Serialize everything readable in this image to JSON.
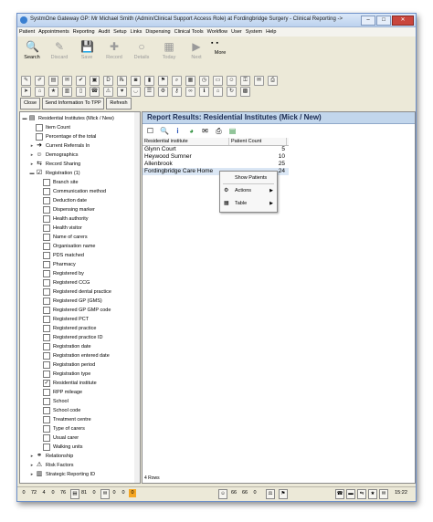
{
  "window": {
    "title": "SystmOne Gateway GP: Mr Michael Smith (Admin/Clinical Support Access Role) at Fordingbridge Surgery - Clinical Reporting ->",
    "controls": [
      "–",
      "□",
      "✕"
    ]
  },
  "menu": [
    "Patient",
    "Appointments",
    "Reporting",
    "Audit",
    "Setup",
    "Links",
    "Dispensing",
    "Clinical Tools",
    "Workflow",
    "User",
    "System",
    "Help"
  ],
  "toolbar": {
    "buttons": [
      {
        "label": "Search",
        "icon": "magnifier-icon",
        "glyph": "🔍",
        "disabled": false
      },
      {
        "label": "Discard",
        "icon": "discard-icon",
        "glyph": "✎",
        "disabled": true
      },
      {
        "label": "Save",
        "icon": "save-icon",
        "glyph": "💾",
        "disabled": true
      },
      {
        "label": "Record",
        "icon": "record-icon",
        "glyph": "✚",
        "disabled": true
      },
      {
        "label": "Details",
        "icon": "details-icon",
        "glyph": "○",
        "disabled": true
      },
      {
        "label": "Today",
        "icon": "today-icon",
        "glyph": "▦",
        "disabled": true
      },
      {
        "label": "Next",
        "icon": "next-icon",
        "glyph": "▶",
        "disabled": true
      },
      {
        "label": "More",
        "icon": "more-icon",
        "glyph": "▪",
        "disabled": false
      }
    ]
  },
  "buttons": {
    "close": "Close",
    "send_info": "Send Information To TPP",
    "refresh": "Refresh"
  },
  "tree": [
    {
      "label": "Residential Institutes (Mick / New)",
      "level": 0,
      "expander": "▬",
      "icon": "doc-icon",
      "glyph": "▤",
      "checkbox": false
    },
    {
      "label": "Item Count",
      "level": 1,
      "checkbox": true,
      "checked": false
    },
    {
      "label": "Percentage of the total",
      "level": 1,
      "checkbox": true,
      "checked": false
    },
    {
      "label": "Current Referrals In",
      "level": 1,
      "expander": "▸",
      "icon": "arrow-right-icon",
      "glyph": "➜",
      "checkbox": false
    },
    {
      "label": "Demographics",
      "level": 1,
      "expander": "▸",
      "icon": "people-icon",
      "glyph": "☺",
      "checkbox": false
    },
    {
      "label": "Record Sharing",
      "level": 1,
      "expander": "▸",
      "icon": "sharing-icon",
      "glyph": "⇆",
      "checkbox": false
    },
    {
      "label": "Registration (1)",
      "level": 1,
      "expander": "▬",
      "icon": "registration-icon",
      "glyph": "☑",
      "checkbox": false
    },
    {
      "label": "Branch site",
      "level": 2,
      "checkbox": true,
      "checked": false
    },
    {
      "label": "Communication method",
      "level": 2,
      "checkbox": true,
      "checked": false
    },
    {
      "label": "Deduction date",
      "level": 2,
      "checkbox": true,
      "checked": false
    },
    {
      "label": "Dispensing marker",
      "level": 2,
      "checkbox": true,
      "checked": false
    },
    {
      "label": "Health authority",
      "level": 2,
      "checkbox": true,
      "checked": false
    },
    {
      "label": "Health visitor",
      "level": 2,
      "checkbox": true,
      "checked": false
    },
    {
      "label": "Name of carers",
      "level": 2,
      "checkbox": true,
      "checked": false
    },
    {
      "label": "Organisation name",
      "level": 2,
      "checkbox": true,
      "checked": false
    },
    {
      "label": "PDS matched",
      "level": 2,
      "checkbox": true,
      "checked": false
    },
    {
      "label": "Pharmacy",
      "level": 2,
      "checkbox": true,
      "checked": false
    },
    {
      "label": "Registered by",
      "level": 2,
      "checkbox": true,
      "checked": false
    },
    {
      "label": "Registered CCG",
      "level": 2,
      "checkbox": true,
      "checked": false
    },
    {
      "label": "Registered dental practice",
      "level": 2,
      "checkbox": true,
      "checked": false
    },
    {
      "label": "Registered GP (GMS)",
      "level": 2,
      "checkbox": true,
      "checked": false
    },
    {
      "label": "Registered GP GMP code",
      "level": 2,
      "checkbox": true,
      "checked": false
    },
    {
      "label": "Registered PCT",
      "level": 2,
      "checkbox": true,
      "checked": false
    },
    {
      "label": "Registered practice",
      "level": 2,
      "checkbox": true,
      "checked": false
    },
    {
      "label": "Registered practice ID",
      "level": 2,
      "checkbox": true,
      "checked": false
    },
    {
      "label": "Registration date",
      "level": 2,
      "checkbox": true,
      "checked": false
    },
    {
      "label": "Registration entered date",
      "level": 2,
      "checkbox": true,
      "checked": false
    },
    {
      "label": "Registration period",
      "level": 2,
      "checkbox": true,
      "checked": false
    },
    {
      "label": "Registration type",
      "level": 2,
      "checkbox": true,
      "checked": false
    },
    {
      "label": "Residential institute",
      "level": 2,
      "checkbox": true,
      "checked": true
    },
    {
      "label": "RPP mileage",
      "level": 2,
      "checkbox": true,
      "checked": false
    },
    {
      "label": "School",
      "level": 2,
      "checkbox": true,
      "checked": false
    },
    {
      "label": "School code",
      "level": 2,
      "checkbox": true,
      "checked": false
    },
    {
      "label": "Treatment centre",
      "level": 2,
      "checkbox": true,
      "checked": false
    },
    {
      "label": "Type of carers",
      "level": 2,
      "checkbox": true,
      "checked": false
    },
    {
      "label": "Usual carer",
      "level": 2,
      "checkbox": true,
      "checked": false
    },
    {
      "label": "Walking units",
      "level": 2,
      "checkbox": true,
      "checked": false
    },
    {
      "label": "Relationship",
      "level": 1,
      "expander": "▸",
      "icon": "relationship-icon",
      "glyph": "⚭",
      "checkbox": false
    },
    {
      "label": "Risk Factors",
      "level": 1,
      "expander": "▸",
      "icon": "risk-icon",
      "glyph": "⚠",
      "checkbox": false
    },
    {
      "label": "Strategic Reporting ID",
      "level": 1,
      "expander": "▸",
      "icon": "strategic-icon",
      "glyph": "▥",
      "checkbox": false
    }
  ],
  "report": {
    "title": "Report Results: Residential Institutes (Mick / New)",
    "columns": [
      "Residential institute",
      "Patient Count"
    ],
    "rows": [
      {
        "name": "Glynn Court",
        "count": "5"
      },
      {
        "name": "Heywood Sumner",
        "count": "10"
      },
      {
        "name": "Allenbrook",
        "count": "25"
      },
      {
        "name": "Fordingbridge Care Home",
        "count": "24"
      }
    ],
    "row_count": "4 Rows"
  },
  "context_menu": {
    "items": [
      {
        "label": "Show Patients",
        "icon": "",
        "submenu": false
      },
      {
        "label": "Actions",
        "icon": "actions-icon",
        "glyph": "⚙",
        "submenu": true
      },
      {
        "label": "Table",
        "icon": "table-icon",
        "glyph": "▦",
        "submenu": true
      }
    ]
  },
  "statusbar": {
    "cells": [
      "0",
      "72",
      "4",
      "0",
      "76",
      "81",
      "0",
      "0",
      "0",
      "0",
      "66",
      "66",
      "0"
    ],
    "time": "15:22"
  }
}
